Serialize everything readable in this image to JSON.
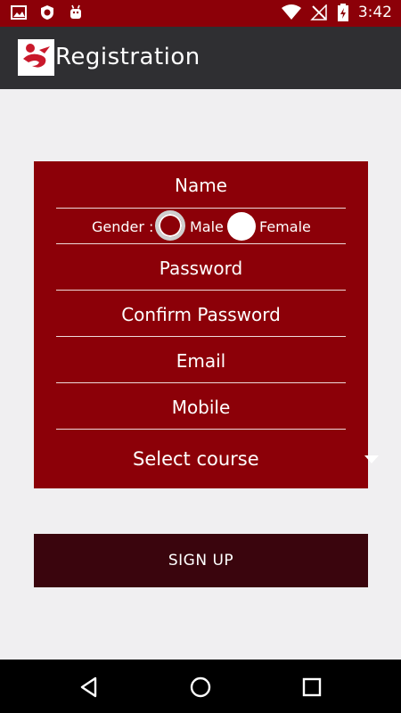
{
  "status_bar": {
    "time": "3:42",
    "icons": [
      "image-icon",
      "shield-icon",
      "android-icon",
      "wifi-icon",
      "no-signal-icon",
      "battery-charging-icon"
    ]
  },
  "app_bar": {
    "title": "Registration",
    "logo": "app-logo-icon"
  },
  "form": {
    "name_placeholder": "Name",
    "gender_label": "Gender :",
    "gender_options": [
      "Male",
      "Female"
    ],
    "password_placeholder": "Password",
    "confirm_password_placeholder": "Confirm Password",
    "email_placeholder": "Email",
    "mobile_placeholder": "Mobile",
    "course_select": "Select course"
  },
  "signup_button": "SIGN UP",
  "nav_bar": {
    "icons": [
      "back-icon",
      "home-icon",
      "recents-icon"
    ]
  },
  "colors": {
    "status_bar": "#8c0008",
    "app_bar": "#2f2f32",
    "form_background": "#8c0008",
    "button_background": "#3a050d",
    "page_background": "#f0eff1"
  }
}
